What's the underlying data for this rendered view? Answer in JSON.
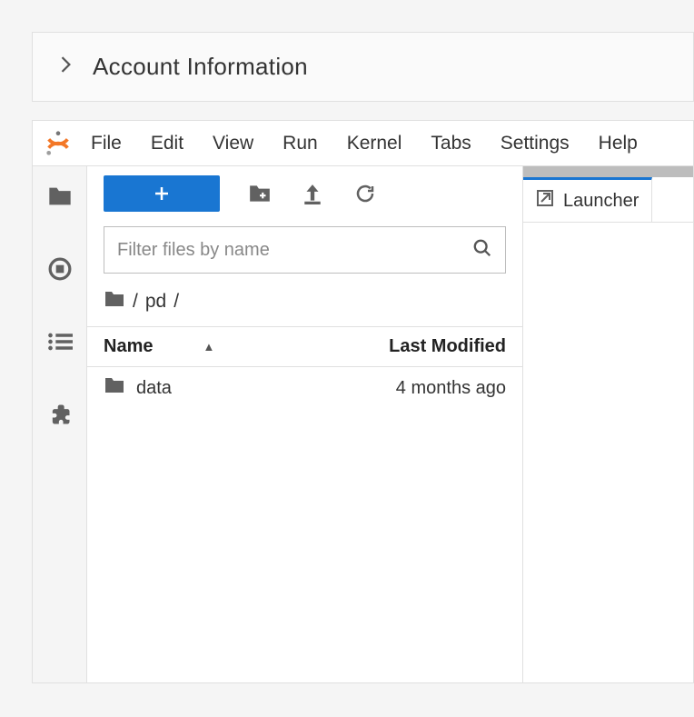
{
  "header": {
    "title": "Account Information"
  },
  "menubar": {
    "items": [
      "File",
      "Edit",
      "View",
      "Run",
      "Kernel",
      "Tabs",
      "Settings",
      "Help"
    ]
  },
  "filebrowser": {
    "filter_placeholder": "Filter files by name",
    "breadcrumb_parts": [
      "/",
      "pd",
      "/"
    ],
    "columns": {
      "name": "Name",
      "modified": "Last Modified"
    },
    "rows": [
      {
        "name": "data",
        "modified": "4 months ago",
        "kind": "folder"
      }
    ]
  },
  "tabs": {
    "active": {
      "label": "Launcher"
    }
  }
}
